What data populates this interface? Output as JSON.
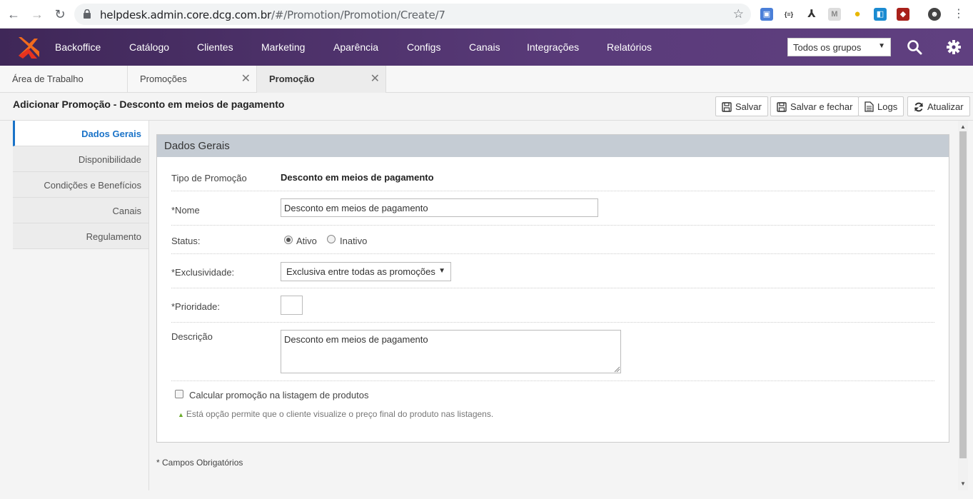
{
  "browser": {
    "url_host": "helpdesk.admin.core.dcg.com.br",
    "url_path": "/#/Promotion/Promotion/Create/7"
  },
  "topnav": {
    "menu": [
      "Backoffice",
      "Catálogo",
      "Clientes",
      "Marketing",
      "Aparência",
      "Configs",
      "Canais",
      "Integrações",
      "Relatórios"
    ],
    "group_select": "Todos os grupos",
    "brand_color": "#4a3068"
  },
  "tabs": [
    {
      "label": "Área de Trabalho",
      "closable": false,
      "active": false
    },
    {
      "label": "Promoções",
      "closable": true,
      "active": false
    },
    {
      "label": "Promoção",
      "closable": true,
      "active": true
    }
  ],
  "page": {
    "title": "Adicionar Promoção - Desconto em meios de pagamento",
    "buttons": {
      "save": "Salvar",
      "save_close": "Salvar e fechar",
      "logs": "Logs",
      "refresh": "Atualizar"
    }
  },
  "leftmenu": {
    "items": [
      "Dados Gerais",
      "Disponibilidade",
      "Condições e Benefícios",
      "Canais",
      "Regulamento"
    ]
  },
  "form": {
    "section_title": "Dados Gerais",
    "tipo_label": "Tipo de Promoção",
    "tipo_value": "Desconto em meios de pagamento",
    "nome_label": "*Nome",
    "nome_value": "Desconto em meios de pagamento",
    "status_label": "Status:",
    "status_ativo": "Ativo",
    "status_inativo": "Inativo",
    "exclusividade_label": "*Exclusividade:",
    "exclusividade_value": "Exclusiva entre todas as promoções",
    "prioridade_label": "*Prioridade:",
    "prioridade_value": "",
    "descricao_label": "Descrição",
    "descricao_value": "Desconto em meios de pagamento",
    "calc_label": "Calcular promoção na listagem de produtos",
    "calc_hint": "Está opção permite que o cliente visualize o preço final do produto nas listagens.",
    "required_note": "* Campos Obrigatórios"
  }
}
